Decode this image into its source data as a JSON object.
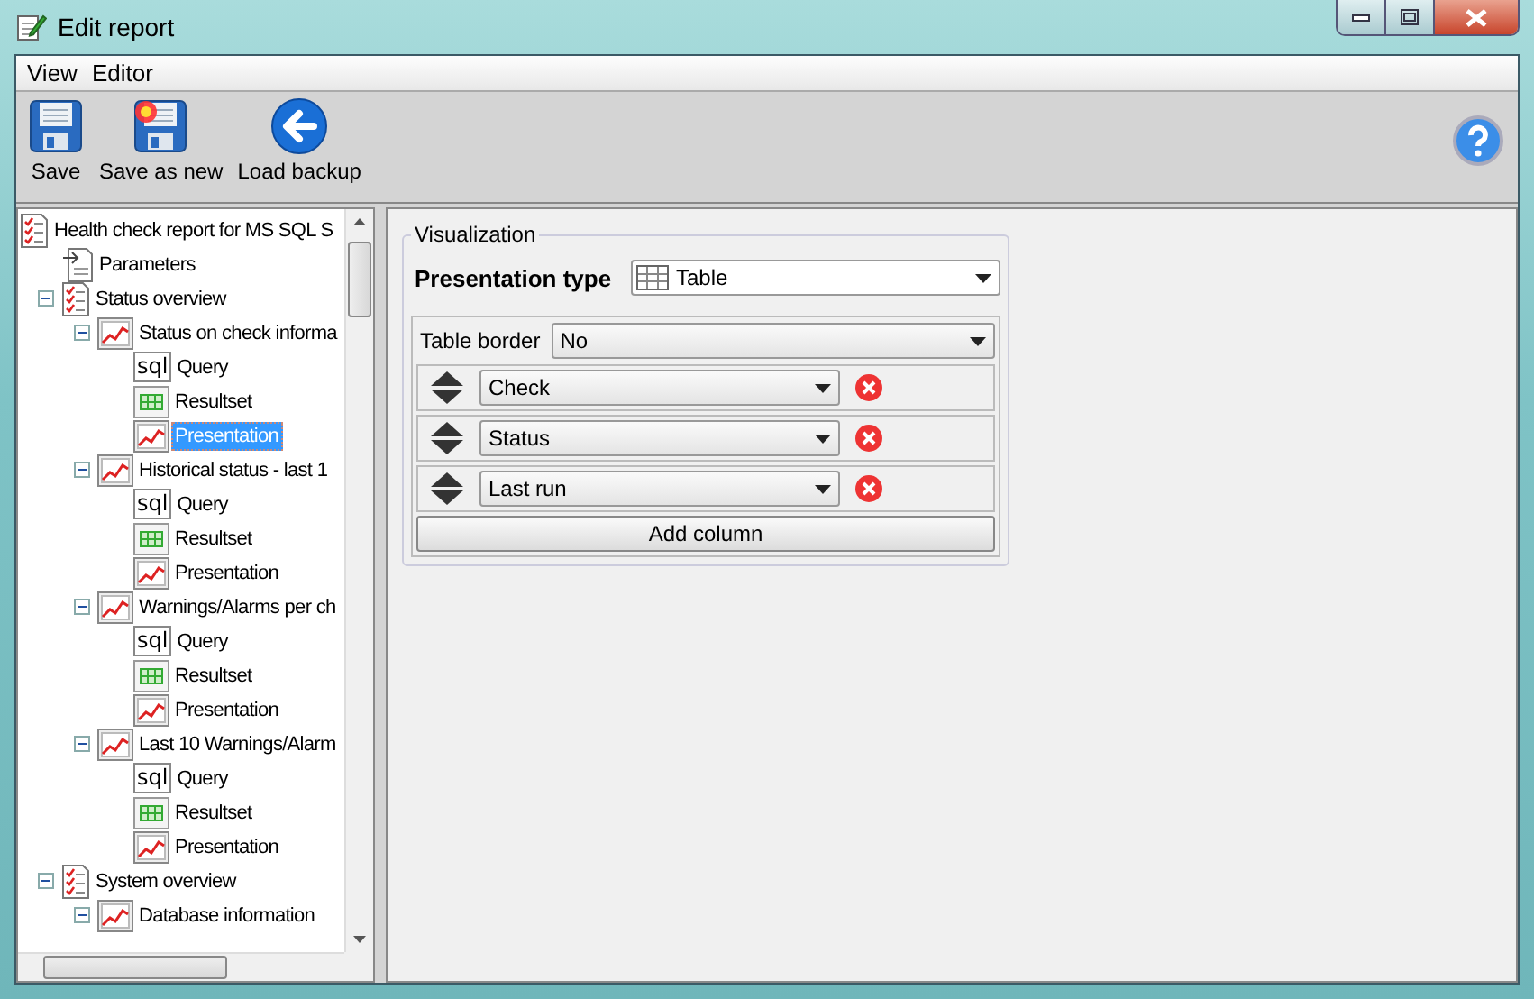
{
  "window": {
    "title": "Edit report"
  },
  "menu": [
    {
      "label": "View"
    },
    {
      "label": "Editor"
    }
  ],
  "toolbar": [
    {
      "label": "Save",
      "kind": "save"
    },
    {
      "label": "Save as new",
      "kind": "save_new"
    },
    {
      "label": "Load backup",
      "kind": "back"
    }
  ],
  "tree": {
    "items": [
      {
        "label": "Health check report for MS SQL S",
        "kind": "report",
        "selected": false,
        "children": [
          {
            "label": "Parameters",
            "kind": "params",
            "selected": false
          },
          {
            "label": "Status overview",
            "kind": "report",
            "selected": false,
            "expanded": true,
            "children": [
              {
                "label": "Status on check informa",
                "kind": "chart",
                "selected": false,
                "expanded": true,
                "children": [
                  {
                    "label": "Query",
                    "kind": "query",
                    "badge": "sql",
                    "selected": false
                  },
                  {
                    "label": "Resultset",
                    "kind": "resultset",
                    "selected": false
                  },
                  {
                    "label": "Presentation",
                    "kind": "chart",
                    "selected": true
                  }
                ]
              },
              {
                "label": "Historical status - last 1",
                "kind": "chart",
                "selected": false,
                "expanded": true,
                "children": [
                  {
                    "label": "Query",
                    "kind": "query",
                    "badge": "sql",
                    "selected": false
                  },
                  {
                    "label": "Resultset",
                    "kind": "resultset",
                    "selected": false
                  },
                  {
                    "label": "Presentation",
                    "kind": "chart",
                    "selected": false
                  }
                ]
              },
              {
                "label": "Warnings/Alarms per ch",
                "kind": "chart",
                "selected": false,
                "expanded": true,
                "children": [
                  {
                    "label": "Query",
                    "kind": "query",
                    "badge": "sql",
                    "selected": false
                  },
                  {
                    "label": "Resultset",
                    "kind": "resultset",
                    "selected": false
                  },
                  {
                    "label": "Presentation",
                    "kind": "chart",
                    "selected": false
                  }
                ]
              },
              {
                "label": "Last 10 Warnings/Alarm",
                "kind": "chart",
                "selected": false,
                "expanded": true,
                "children": [
                  {
                    "label": "Query",
                    "kind": "query",
                    "badge": "sql",
                    "selected": false
                  },
                  {
                    "label": "Resultset",
                    "kind": "resultset",
                    "selected": false
                  },
                  {
                    "label": "Presentation",
                    "kind": "chart",
                    "selected": false
                  }
                ]
              }
            ]
          },
          {
            "label": "System overview",
            "kind": "report",
            "selected": false,
            "expanded": true,
            "children": [
              {
                "label": "Database information",
                "kind": "chart",
                "selected": false,
                "expanded": true
              }
            ]
          }
        ]
      }
    ]
  },
  "visualization": {
    "title": "Visualization",
    "presentation_type": {
      "label": "Presentation type",
      "value": "Table"
    },
    "table_border": {
      "label": "Table border",
      "value": "No"
    },
    "columns": [
      {
        "value": "Check"
      },
      {
        "value": "Status"
      },
      {
        "value": "Last run"
      }
    ],
    "add_button": "Add column"
  }
}
